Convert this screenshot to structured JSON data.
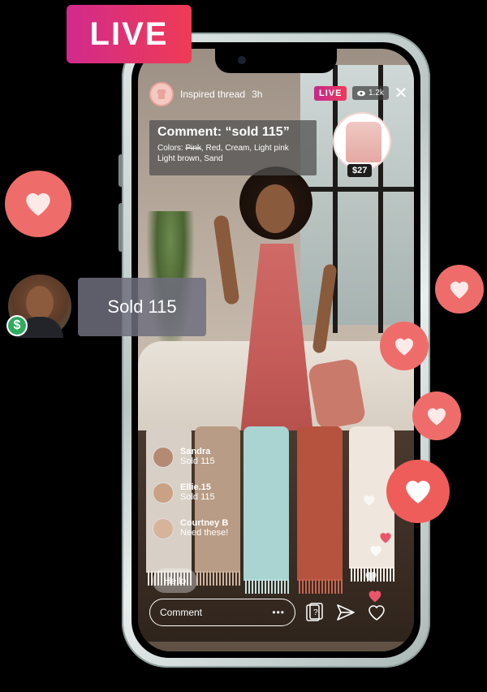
{
  "live_badge": "LIVE",
  "sold_card": "Sold 115",
  "buyer_badge_symbol": "$",
  "stream": {
    "shop_name": "Inspired thread",
    "time_ago": "3h",
    "live_label": "LIVE",
    "viewers": "1.2k",
    "close_icon": "close-icon",
    "comment_card": {
      "title": "Comment: “sold 115”",
      "colors_prefix": "Colors:",
      "color_struck": "Pink",
      "colors_rest": ", Red, Cream, Light pink",
      "colors_line2": "Light brown, Sand"
    },
    "product_price": "$27",
    "chat": [
      {
        "name": "Sandra",
        "message": "Sold 115"
      },
      {
        "name": "Ellie.15",
        "message": "Sold 115"
      },
      {
        "name": "Courtney B",
        "message": "Need these!"
      }
    ],
    "hello_pill": "Hello",
    "comment_placeholder": "Comment",
    "more_icon": "more-icon",
    "question_icon": "question-card-icon",
    "send_icon": "send-icon",
    "heart_icon": "heart-icon"
  },
  "colors": {
    "accent_gradient_start": "#d12a8c",
    "accent_gradient_end": "#ef3b55",
    "heart_bubble": "#ee6d6a",
    "dollar_badge": "#2faa60"
  }
}
